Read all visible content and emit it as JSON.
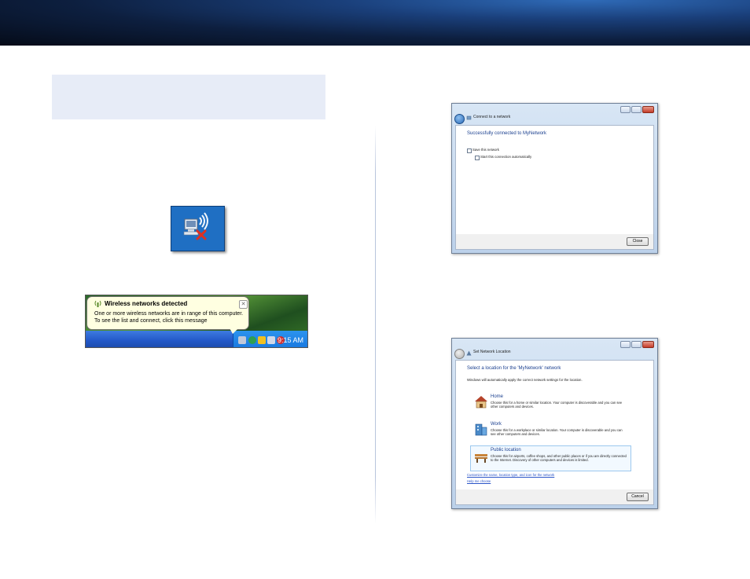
{
  "xp_balloon": {
    "title": "Wireless networks detected",
    "line1": "One or more wireless networks are in range of this computer.",
    "line2": "To see the list and connect, click this message",
    "close_glyph": "✕",
    "clock": "9:15 AM"
  },
  "connect_window": {
    "title": "Connect to a network",
    "heading": "Successfully connected to MyNetwork",
    "checkbox1_label": "Save this network",
    "checkbox2_label": "Start this connection automatically",
    "close_button": "Close"
  },
  "location_window": {
    "title": "Set Network Location",
    "heading": "Select a location for the 'MyNetwork' network",
    "subtext": "Windows will automatically apply the correct network settings for the location.",
    "options": [
      {
        "title": "Home",
        "desc": "Choose this for a home or similar location. Your computer is discoverable and you can see other computers and devices."
      },
      {
        "title": "Work",
        "desc": "Choose this for a workplace or similar location. Your computer is discoverable and you can see other computers and devices."
      },
      {
        "title": "Public location",
        "desc": "Choose this for airports, coffee shops, and other public places or if you are directly connected to the Internet. Discovery of other computers and devices is limited."
      }
    ],
    "link1": "Customize the name, location type, and icon for the network",
    "link2": "Help me choose",
    "cancel_button": "Cancel"
  },
  "colors": {
    "banner_dark": "#050b18",
    "banner_light": "#2f6bb8",
    "note_box": "#e7ecf7",
    "heading_blue": "#1a3f8f",
    "link_blue": "#2b55c8"
  }
}
